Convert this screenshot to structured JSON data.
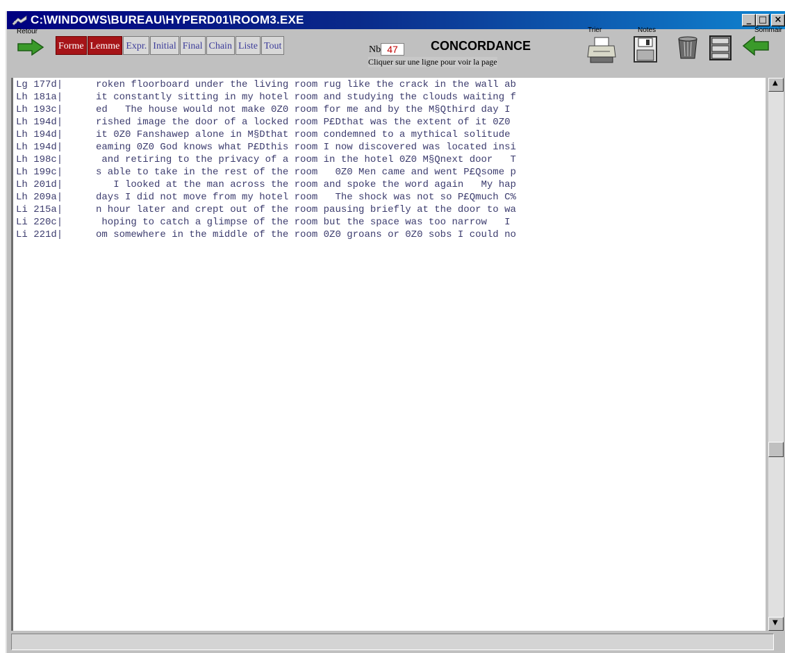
{
  "window": {
    "title": "C:\\WINDOWS\\BUREAU\\HYPERD01\\ROOM3.EXE",
    "controls": {
      "minimize": "_",
      "maximize": "□",
      "close": "×"
    }
  },
  "toolbar": {
    "retour_label": "Retour",
    "tabs": [
      {
        "label": "Forme",
        "selected": true
      },
      {
        "label": "Lemme",
        "selected": true
      },
      {
        "label": "Expr.",
        "selected": false
      },
      {
        "label": "Initial",
        "selected": false
      },
      {
        "label": "Final",
        "selected": false
      },
      {
        "label": "Chain",
        "selected": false
      },
      {
        "label": "Liste",
        "selected": false
      },
      {
        "label": "Tout",
        "selected": false
      }
    ],
    "nb_label": "Nb",
    "nb_value": "47",
    "title": "CONCORDANCE",
    "subtitle": "Cliquer sur une ligne pour voir la page",
    "trier_label": "Trier",
    "notes_label": "Notes",
    "sommaire_label": "Sommair",
    "icons": [
      "green-arrow-icon",
      "printer-icon",
      "floppy-disk-icon",
      "trash-can-icon",
      "file-cabinet-icon"
    ],
    "colors": {
      "selected_tab": "#a61418",
      "nb_value": "#c00000",
      "arrow": "#3a9a2a"
    }
  },
  "concordance": {
    "rows": [
      {
        "ref": "Lg 177d|",
        "text": "roken floorboard under the living room rug like the crack in the wall ab"
      },
      {
        "ref": "Lh 181a|",
        "text": "it constantly sitting in my hotel room and studying the clouds waiting f"
      },
      {
        "ref": "Lh 193c|",
        "text": "ed   The house would not make 0Z0 room for me and by the M§Qthird day I"
      },
      {
        "ref": "Lh 194d|",
        "text": "rished image the door of a locked room P£Dthat was the extent of it 0Z0"
      },
      {
        "ref": "Lh 194d|",
        "text": "it 0Z0 Fanshawep alone in M§Dthat room condemned to a mythical solitude"
      },
      {
        "ref": "Lh 194d|",
        "text": "eaming 0Z0 God knows what P£Dthis room I now discovered was located insi"
      },
      {
        "ref": "Lh 198c|",
        "text": " and retiring to the privacy of a room in the hotel 0Z0 M§Qnext door   T"
      },
      {
        "ref": "Lh 199c|",
        "text": "s able to take in the rest of the room   0Z0 Men came and went P£Qsome p"
      },
      {
        "ref": "Lh 201d|",
        "text": "   I looked at the man across the room and spoke the word again   My hap"
      },
      {
        "ref": "Lh 209a|",
        "text": "days I did not move from my hotel room   The shock was not so P£Qmuch C%"
      },
      {
        "ref": "Li 215a|",
        "text": "n hour later and crept out of the room pausing briefly at the door to wa"
      },
      {
        "ref": "Li 220c|",
        "text": " hoping to catch a glimpse of the room but the space was too narrow   I"
      },
      {
        "ref": "Li 221d|",
        "text": "om somewhere in the middle of the room 0Z0 groans or 0Z0 sobs I could no"
      }
    ]
  },
  "scrollbar": {
    "up": "▲",
    "down": "▼"
  }
}
